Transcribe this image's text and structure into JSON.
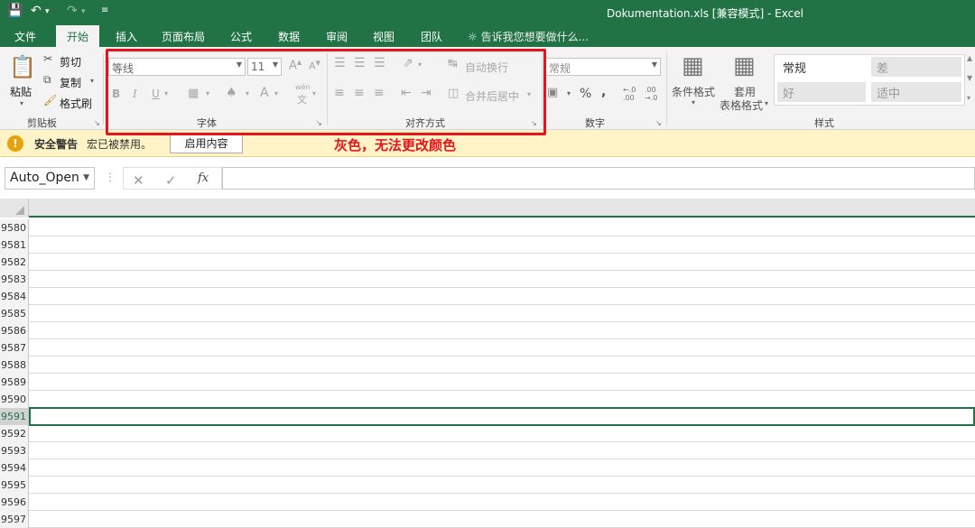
{
  "titlebar": {
    "title": "Dokumentation.xls  [兼容模式] - Excel",
    "save_icon": "save-icon",
    "undo_icon": "undo-icon",
    "redo_icon": "redo-icon"
  },
  "tabs": [
    {
      "label": "文件",
      "active": false
    },
    {
      "label": "开始",
      "active": true
    },
    {
      "label": "插入",
      "active": false
    },
    {
      "label": "页面布局",
      "active": false
    },
    {
      "label": "公式",
      "active": false
    },
    {
      "label": "数据",
      "active": false
    },
    {
      "label": "审阅",
      "active": false
    },
    {
      "label": "视图",
      "active": false
    },
    {
      "label": "团队",
      "active": false
    }
  ],
  "tell_me": "告诉我您想要做什么...",
  "ribbon": {
    "clipboard": {
      "paste": "粘贴",
      "cut": "剪切",
      "copy": "复制",
      "format_painter": "格式刷",
      "label": "剪贴板"
    },
    "font": {
      "name": "等线",
      "size": "11",
      "bold": "B",
      "italic": "I",
      "underline": "U",
      "grow": "A",
      "shrink": "A",
      "wen": "wén",
      "wen_sub": "文",
      "label": "字体"
    },
    "alignment": {
      "wrap": "自动换行",
      "merge": "合并后居中",
      "label": "对齐方式"
    },
    "number": {
      "format": "常规",
      "percent": "%",
      "comma": ",",
      "inc_decimal": "←.0 .00",
      "dec_decimal": ".00 →.0",
      "label": "数字"
    },
    "styles": {
      "conditional": "条件格式",
      "table_fmt_1": "套用",
      "table_fmt_2": "表格格式",
      "normal": "常规",
      "bad": "差",
      "good": "好",
      "neutral": "适中",
      "label": "样式"
    }
  },
  "security_bar": {
    "title": "安全警告",
    "message": "宏已被禁用。",
    "button": "启用内容"
  },
  "annotation": "灰色，无法更改颜色",
  "formula_bar": {
    "name_box": "Auto_Open",
    "cancel": "✕",
    "enter": "✓",
    "fx": "fx",
    "content": ""
  },
  "grid": {
    "rows": [
      "9580",
      "9581",
      "9582",
      "9583",
      "9584",
      "9585",
      "9586",
      "9587",
      "9588",
      "9589",
      "9590",
      "9591",
      "9592",
      "9593",
      "9594",
      "9595",
      "9596",
      "9597"
    ],
    "selected_row": "9591"
  },
  "colors": {
    "accent": "#217346",
    "warning_bg": "#fff4c8",
    "highlight": "#e8141c"
  }
}
